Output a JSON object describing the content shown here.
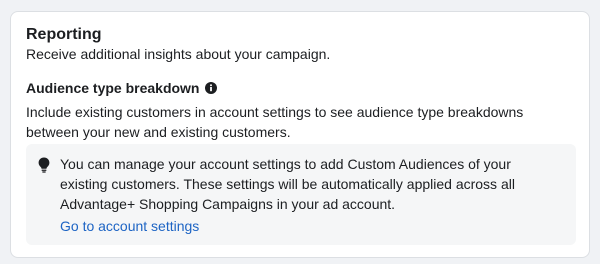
{
  "reporting": {
    "title": "Reporting",
    "subtitle": "Receive additional insights about your campaign."
  },
  "audience_breakdown": {
    "heading": "Audience type breakdown",
    "info_icon": "info-icon",
    "description": "Include existing customers in account settings to see audience type breakdowns between your new and existing customers."
  },
  "notice": {
    "icon": "lightbulb-icon",
    "text": "You can manage your account settings to add Custom Audiences of your existing customers. These settings will be automatically applied across all Advantage+ Shopping Campaigns in your ad account.",
    "link_label": "Go to account settings"
  },
  "colors": {
    "link": "#1d64c4",
    "text": "#1c1e21",
    "notice_bg": "#f5f6f7"
  }
}
